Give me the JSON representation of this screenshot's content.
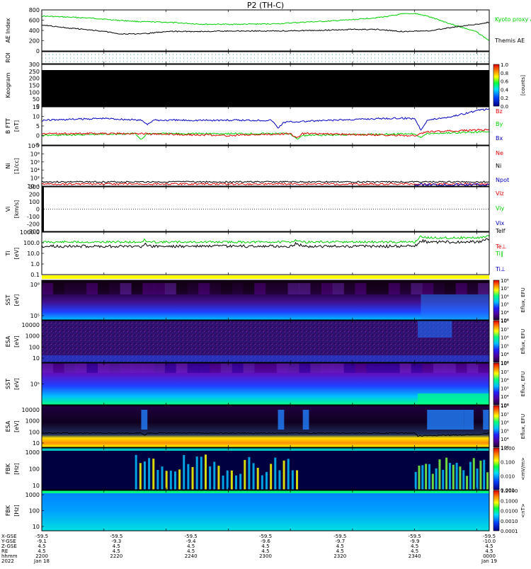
{
  "title": "P2 (TH-C)",
  "colors": {
    "green": "#00d000",
    "red": "#e00000",
    "blue": "#0000c0",
    "yellow": "#ffff00",
    "black": "#000000"
  },
  "chart_data": [
    {
      "type": "line",
      "id": "ae",
      "ylabel": "AE Index",
      "yticks": [
        "800",
        "600",
        "400",
        "200",
        "0"
      ],
      "ylim": [
        0,
        800
      ],
      "legend": [
        "Kyoto proxy AE",
        "Themis AE"
      ],
      "series": [
        {
          "name": "Kyoto proxy AE",
          "color": "green",
          "x": [
            0,
            8,
            16,
            24,
            32,
            40,
            52,
            64,
            76,
            84,
            92,
            100,
            108,
            112,
            116,
            120,
            124,
            132,
            140,
            144
          ],
          "values": [
            680,
            660,
            640,
            600,
            570,
            560,
            520,
            520,
            530,
            560,
            580,
            610,
            650,
            680,
            720,
            730,
            680,
            520,
            370,
            200
          ]
        },
        {
          "name": "Themis AE",
          "color": "black",
          "x": [
            0,
            4,
            8,
            14,
            20,
            26,
            32,
            40,
            52,
            64,
            76,
            88,
            100,
            108,
            116,
            124,
            132,
            140,
            144
          ],
          "values": [
            510,
            480,
            450,
            420,
            380,
            330,
            330,
            380,
            380,
            390,
            390,
            400,
            420,
            420,
            380,
            390,
            460,
            520,
            560
          ]
        }
      ]
    },
    {
      "type": "heatmap",
      "id": "roi",
      "ylabel": "ROI",
      "yticks": []
    },
    {
      "type": "heatmap",
      "id": "keogram",
      "ylabel": "Keogram",
      "yticks": [
        "300",
        "250",
        "200",
        "150",
        "100",
        "50",
        "0"
      ],
      "colorbar": {
        "label": "[counts]",
        "ticks": [
          "1.0",
          "0.8",
          "0.6",
          "0.4",
          "0.2",
          "0.0"
        ]
      }
    },
    {
      "type": "line",
      "id": "bfield",
      "ylabel": "B FTT",
      "yunit": "[nT]",
      "yticks": [
        "15",
        "10",
        "5",
        "0",
        "-5"
      ],
      "ylim": [
        -5,
        15
      ],
      "legend": [
        "Bz",
        "By",
        "Bx"
      ],
      "series": [
        {
          "name": "Bz",
          "color": "blue",
          "x": [
            0,
            20,
            32,
            34,
            36,
            60,
            74,
            76,
            78,
            110,
            120,
            122,
            124,
            132,
            140,
            144
          ],
          "values": [
            8,
            9,
            8,
            6,
            8,
            8,
            8,
            4,
            7,
            9,
            9,
            3,
            8,
            10,
            13,
            14
          ]
        },
        {
          "name": "By",
          "color": "green",
          "x": [
            0,
            30,
            32,
            34,
            80,
            82,
            84,
            120,
            122,
            124,
            144
          ],
          "values": [
            0,
            1,
            -2,
            1,
            1,
            -2,
            0,
            1,
            -1,
            1,
            2
          ]
        },
        {
          "name": "Bx",
          "color": "red",
          "x": [
            0,
            30,
            60,
            80,
            82,
            84,
            120,
            124,
            144
          ],
          "values": [
            1,
            1,
            0,
            1,
            -1,
            1,
            0,
            2,
            3
          ]
        }
      ]
    },
    {
      "type": "line",
      "id": "density",
      "ylabel": "Ni",
      "yunit": "[1/cc]",
      "yticks": [
        "10¹⁰",
        "10⁸",
        "10⁶",
        "10⁴",
        "10²",
        "10⁻¹"
      ],
      "legend": [
        "Ne",
        "Ni",
        "Npot"
      ]
    },
    {
      "type": "line",
      "id": "velocity",
      "ylabel": "Vi",
      "yunit": "[km/s]",
      "yticks": [
        "300",
        "200",
        "100",
        "0",
        "-100",
        "-200",
        "-300"
      ],
      "ylim": [
        -350,
        350
      ],
      "legend": [
        "Viz",
        "Viy",
        "Vix"
      ]
    },
    {
      "type": "line",
      "id": "temperature",
      "ylabel": "Ti",
      "yunit": "[eV]",
      "yticks": [
        "1000.0",
        "100.0",
        "10.0",
        "1.0",
        "0.1"
      ],
      "legend": [
        "Telf",
        "Te⊥",
        "Ti‖",
        "Ti⊥"
      ]
    },
    {
      "type": "heatmap",
      "id": "sst1",
      "ylabel": "SST",
      "yunit": "[eV]",
      "yticks": [
        "10⁶",
        "10⁵"
      ],
      "colorbar": {
        "label": "Eflux, EFU",
        "ticks": [
          "10⁸",
          "10⁷",
          "10⁶",
          "10⁵",
          "10⁴",
          "10³"
        ]
      }
    },
    {
      "type": "heatmap",
      "id": "esa1",
      "ylabel": "ESA",
      "yunit": "[eV]",
      "yticks": [
        "10000",
        "1000",
        "100",
        "10"
      ],
      "colorbar": {
        "label": "Eflux, EFU",
        "ticks": [
          "10⁸",
          "10⁷",
          "10⁶",
          "10⁵",
          "10⁴",
          "10³"
        ]
      }
    },
    {
      "type": "heatmap",
      "id": "sst2",
      "ylabel": "SST",
      "yunit": "[eV]",
      "yticks": [
        "10⁵"
      ],
      "colorbar": {
        "label": "Eflux, EFU",
        "ticks": [
          "10⁸",
          "10⁷",
          "10⁶",
          "10⁵",
          "10⁴",
          "10³"
        ]
      }
    },
    {
      "type": "heatmap",
      "id": "esa2",
      "ylabel": "ESA",
      "yunit": "[eV]",
      "yticks": [
        "10000",
        "1000",
        "100",
        "10"
      ],
      "colorbar": {
        "label": "Eflux, EFU",
        "ticks": [
          "10⁸",
          "10⁷",
          "10⁶",
          "10⁵",
          "10⁴",
          "10³"
        ]
      }
    },
    {
      "type": "heatmap",
      "id": "fbk1",
      "ylabel": "FBK",
      "yunit": "[Hz]",
      "yticks": [
        "1000",
        "100",
        "10"
      ],
      "colorbar": {
        "label": "<mV/m>",
        "ticks": [
          "1.000",
          "0.100",
          "0.010",
          "0.001"
        ]
      }
    },
    {
      "type": "heatmap",
      "id": "fbk2",
      "ylabel": "FBK",
      "yunit": "[Hz]",
      "yticks": [
        "1000",
        "100",
        "10"
      ],
      "colorbar": {
        "label": "<nT>",
        "ticks": [
          "1.2000",
          "0.1000",
          "0.0100",
          "0.0010",
          "0.0001"
        ]
      }
    }
  ],
  "x_axis": {
    "row_labels": [
      "X-GSE",
      "Y-GSE",
      "Z-GSE",
      "RE",
      "hhmm",
      "2022"
    ],
    "columns": [
      {
        "values": [
          "-59.5",
          "-9.1",
          "4.5",
          "4.5",
          "2200",
          "Jan 18"
        ]
      },
      {
        "values": [
          "-59.5",
          "-9.3",
          "4.5",
          "4.5",
          "2220",
          ""
        ]
      },
      {
        "values": [
          "-59.5",
          "-9.4",
          "4.5",
          "4.5",
          "2240",
          ""
        ]
      },
      {
        "values": [
          "-59.5",
          "-9.6",
          "4.5",
          "4.5",
          "2300",
          ""
        ]
      },
      {
        "values": [
          "-59.5",
          "-9.7",
          "4.5",
          "4.5",
          "2320",
          ""
        ]
      },
      {
        "values": [
          "-59.5",
          "-9.9",
          "4.5",
          "4.5",
          "2340",
          ""
        ]
      },
      {
        "values": [
          "-59.5",
          "-10.0",
          "4.5",
          "4.5",
          "0000",
          "Jan 19"
        ]
      }
    ]
  }
}
